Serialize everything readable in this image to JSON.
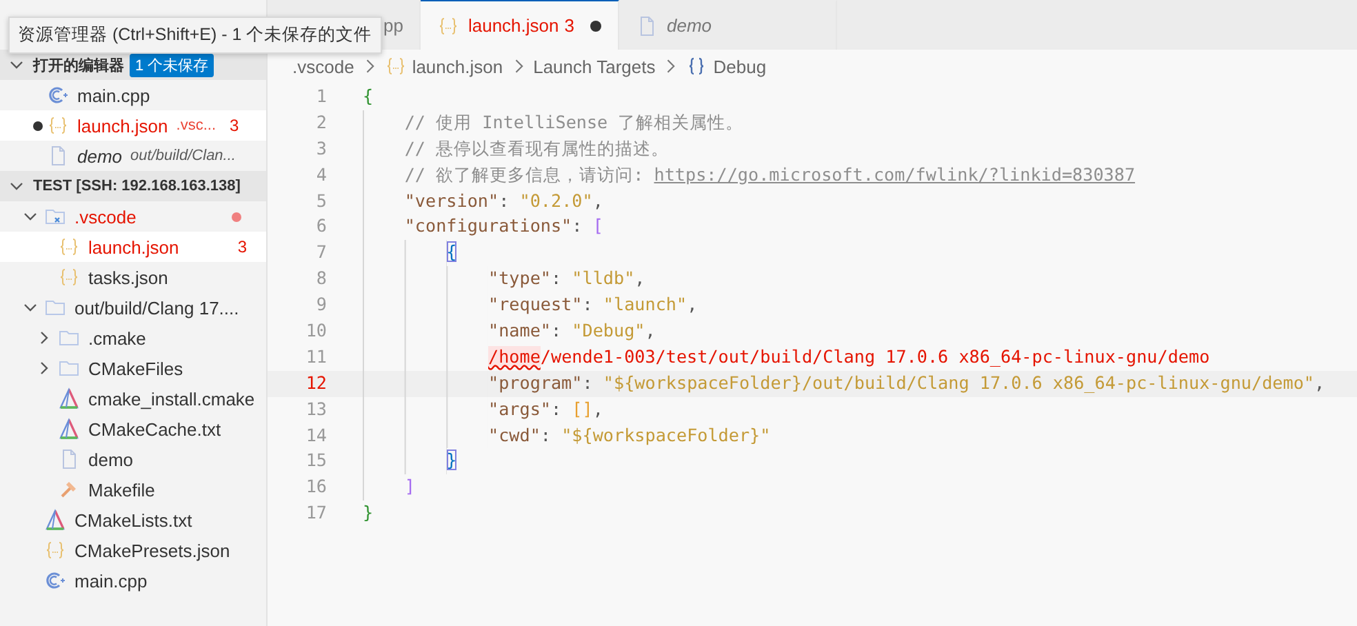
{
  "tooltip": {
    "text": "资源管理器 (Ctrl+Shift+E) - 1 个未保存的文件"
  },
  "sidebar": {
    "open_editors": {
      "title": "打开的编辑器",
      "expanded": true,
      "badge": "1 个未保存",
      "items": [
        {
          "label": "main.cpp",
          "kind": "cpp",
          "dirty": false,
          "preview": false,
          "selected": false,
          "has_errors": false
        },
        {
          "label": "launch.json",
          "kind": "json",
          "description": ".vsc...",
          "errors": "3",
          "dirty": true,
          "preview": false,
          "selected": true,
          "has_errors": true
        },
        {
          "label": "demo",
          "kind": "file",
          "description": "out/build/Clan...",
          "dirty": false,
          "preview": true,
          "selected": false,
          "has_errors": false
        }
      ]
    },
    "workspace": {
      "title": "TEST [SSH: 192.168.163.138]",
      "expanded": true,
      "items": [
        {
          "label": ".vscode",
          "kind": "vscode-folder",
          "expanded": true,
          "has_errors": true,
          "problem_dot": true,
          "selected": false,
          "children": [
            {
              "label": "launch.json",
              "kind": "json",
              "has_errors": true,
              "errors": "3",
              "selected": true
            },
            {
              "label": "tasks.json",
              "kind": "json",
              "has_errors": false,
              "selected": false
            }
          ]
        },
        {
          "label": "out/build/Clang 17....",
          "kind": "folder",
          "expanded": true,
          "has_errors": false,
          "selected": false,
          "children": [
            {
              "label": ".cmake",
              "kind": "folder",
              "expanded": false,
              "has_errors": false,
              "selected": false
            },
            {
              "label": "CMakeFiles",
              "kind": "folder",
              "expanded": false,
              "has_errors": false,
              "selected": false
            },
            {
              "label": "cmake_install.cmake",
              "kind": "cmake",
              "has_errors": false,
              "selected": false
            },
            {
              "label": "CMakeCache.txt",
              "kind": "cmake",
              "has_errors": false,
              "selected": false
            },
            {
              "label": "demo",
              "kind": "file",
              "has_errors": false,
              "selected": false
            },
            {
              "label": "Makefile",
              "kind": "make",
              "has_errors": false,
              "selected": false
            }
          ]
        },
        {
          "label": "CMakeLists.txt",
          "kind": "cmake",
          "has_errors": false,
          "selected": false
        },
        {
          "label": "CMakePresets.json",
          "kind": "json",
          "has_errors": false,
          "selected": false
        },
        {
          "label": "main.cpp",
          "kind": "cpp",
          "has_errors": false,
          "selected": false
        }
      ]
    }
  },
  "tabs": [
    {
      "label": "pp",
      "selected": false,
      "dirty": false,
      "preview": false,
      "has_errors": false
    },
    {
      "label": "launch.json",
      "kind": "json",
      "errors": "3",
      "selected": true,
      "dirty": true,
      "preview": false,
      "has_errors": true
    },
    {
      "label": "demo",
      "kind": "file",
      "selected": false,
      "dirty": false,
      "preview": true,
      "has_errors": false
    }
  ],
  "breadcrumb": [
    {
      "text": ".vscode"
    },
    {
      "text": "launch.json",
      "kind": "json"
    },
    {
      "text": "Launch Targets"
    },
    {
      "text": "Debug",
      "kind": "braces"
    }
  ],
  "editor": {
    "lines": [
      {
        "number": "1",
        "current": false,
        "tokens": [
          {
            "kind": "bracket1",
            "text": "{"
          }
        ],
        "children": [
          {
            "number": "2",
            "current": false,
            "tokens": [
              {
                "kind": "comment",
                "text": "// 使用 IntelliSense 了解相关属性。"
              }
            ]
          },
          {
            "number": "3",
            "current": false,
            "tokens": [
              {
                "kind": "comment",
                "text": "// 悬停以查看现有属性的描述。"
              }
            ]
          },
          {
            "number": "4",
            "current": false,
            "tokens": [
              {
                "kind": "comment",
                "text": "// 欲了解更多信息，请访问: "
              },
              {
                "kind": "link",
                "text": "https://go.microsoft.com/fwlink/?linkid=830387"
              }
            ]
          },
          {
            "number": "5",
            "current": false,
            "tokens": [
              {
                "kind": "key",
                "text": "\"version\""
              },
              {
                "kind": "punct",
                "text": ": "
              },
              {
                "kind": "string",
                "text": "\"0.2.0\""
              },
              {
                "kind": "punct",
                "text": ","
              }
            ]
          },
          {
            "number": "6",
            "current": false,
            "tokens": [
              {
                "kind": "key",
                "text": "\"configurations\""
              },
              {
                "kind": "punct",
                "text": ": "
              },
              {
                "kind": "bracket2",
                "text": "["
              }
            ],
            "children": [
              {
                "number": "7",
                "current": false,
                "tokens": [
                  {
                    "kind": "bracket3-match",
                    "text": "{"
                  }
                ],
                "children": [
                  {
                    "number": "8",
                    "current": false,
                    "tokens": [
                      {
                        "kind": "key",
                        "text": "\"type\""
                      },
                      {
                        "kind": "punct",
                        "text": ": "
                      },
                      {
                        "kind": "string",
                        "text": "\"lldb\""
                      },
                      {
                        "kind": "punct",
                        "text": ","
                      }
                    ]
                  },
                  {
                    "number": "9",
                    "current": false,
                    "tokens": [
                      {
                        "kind": "key",
                        "text": "\"request\""
                      },
                      {
                        "kind": "punct",
                        "text": ": "
                      },
                      {
                        "kind": "string",
                        "text": "\"launch\""
                      },
                      {
                        "kind": "punct",
                        "text": ","
                      }
                    ]
                  },
                  {
                    "number": "10",
                    "current": false,
                    "tokens": [
                      {
                        "kind": "key",
                        "text": "\"name\""
                      },
                      {
                        "kind": "punct",
                        "text": ": "
                      },
                      {
                        "kind": "string",
                        "text": "\"Debug\""
                      },
                      {
                        "kind": "punct",
                        "text": ","
                      }
                    ]
                  },
                  {
                    "number": "11",
                    "current": false,
                    "tokens": [
                      {
                        "kind": "error-squiggle",
                        "text": "/home"
                      },
                      {
                        "kind": "error",
                        "text": "/wende1-003/test/out/build/Clang 17.0.6 x86_64-pc-linux-gnu/demo"
                      }
                    ]
                  },
                  {
                    "number": "12",
                    "current": true,
                    "tokens": [
                      {
                        "kind": "key",
                        "text": "\"program\""
                      },
                      {
                        "kind": "punct",
                        "text": ": "
                      },
                      {
                        "kind": "string",
                        "text": "\"${workspaceFolder}/out/build/Clang 17.0.6 x86_64-pc-linux-gnu/demo\""
                      },
                      {
                        "kind": "punct",
                        "text": ","
                      }
                    ]
                  },
                  {
                    "number": "13",
                    "current": false,
                    "tokens": [
                      {
                        "kind": "key",
                        "text": "\"args\""
                      },
                      {
                        "kind": "punct",
                        "text": ": "
                      },
                      {
                        "kind": "bracket-array",
                        "text": "[]"
                      },
                      {
                        "kind": "punct",
                        "text": ","
                      }
                    ]
                  },
                  {
                    "number": "14",
                    "current": false,
                    "tokens": [
                      {
                        "kind": "key",
                        "text": "\"cwd\""
                      },
                      {
                        "kind": "punct",
                        "text": ": "
                      },
                      {
                        "kind": "string",
                        "text": "\"${workspaceFolder}\""
                      }
                    ]
                  }
                ]
              },
              {
                "number": "15",
                "current": false,
                "tokens": [
                  {
                    "kind": "bracket3-match",
                    "text": "}"
                  }
                ]
              }
            ]
          },
          {
            "number": "16",
            "current": false,
            "tokens": [
              {
                "kind": "bracket2",
                "text": "]"
              }
            ]
          }
        ]
      },
      {
        "number": "17",
        "current": false,
        "tokens": [
          {
            "kind": "bracket1",
            "text": "}"
          }
        ]
      }
    ]
  }
}
